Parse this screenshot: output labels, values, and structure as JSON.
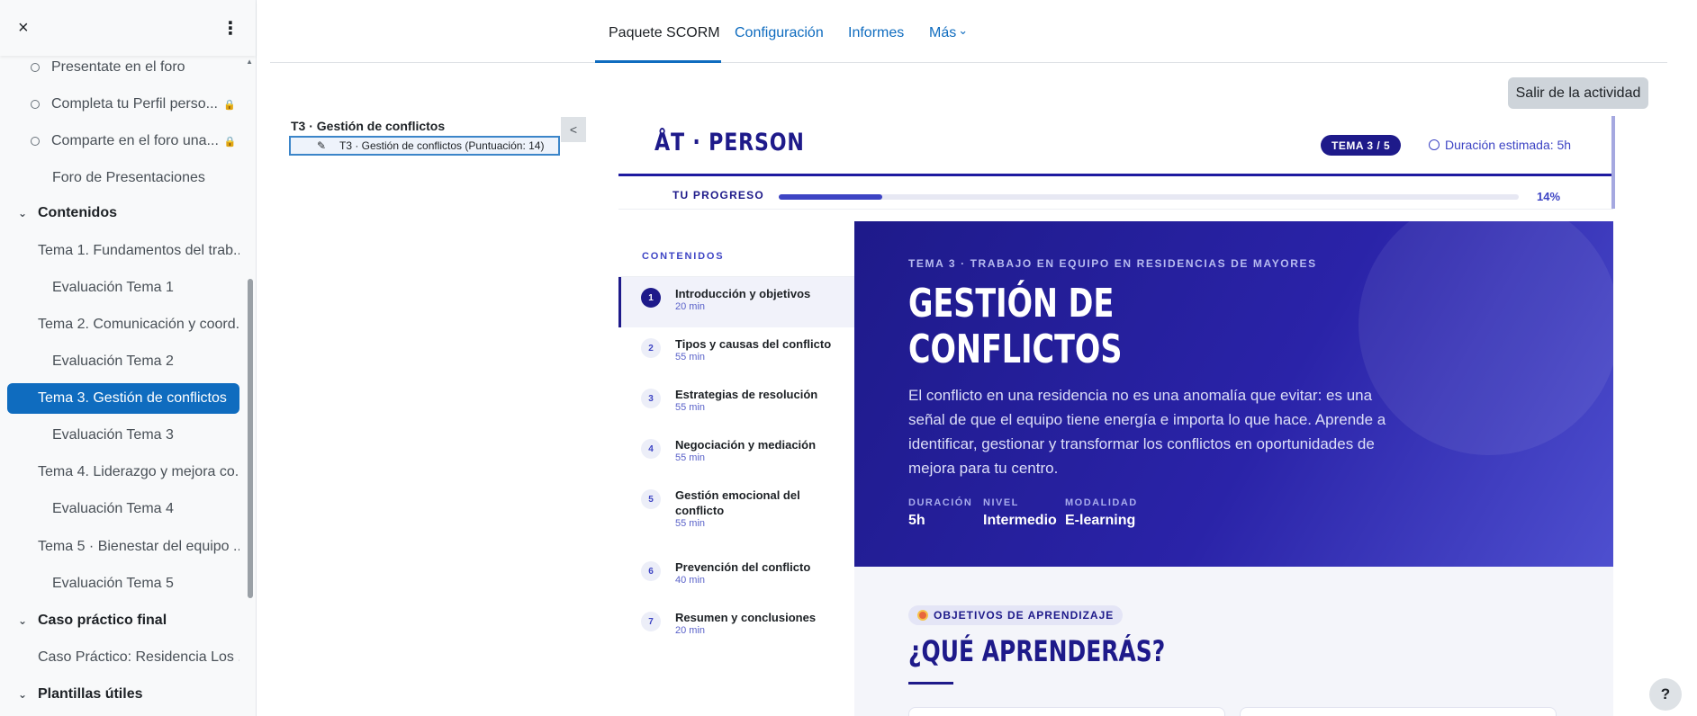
{
  "drawer": {
    "close_icon": "×",
    "menu_icon": "⋮",
    "items": [
      {
        "label": "Presentate en el foro",
        "kind": "activity",
        "circle": true,
        "lock": false,
        "active": false
      },
      {
        "label": "Completa tu Perfil perso...",
        "kind": "activity",
        "circle": true,
        "lock": true,
        "active": false
      },
      {
        "label": "Comparte en el foro una...",
        "kind": "activity",
        "circle": true,
        "lock": true,
        "active": false
      },
      {
        "label": "Foro de Presentaciones",
        "kind": "activity",
        "circle": false,
        "lock": false,
        "active": false
      },
      {
        "label": "Contenidos",
        "kind": "section"
      },
      {
        "label": "Tema 1. Fundamentos del trab...",
        "kind": "topic"
      },
      {
        "label": "Evaluación Tema 1",
        "kind": "activity",
        "circle": false
      },
      {
        "label": "Tema 2. Comunicación y coord...",
        "kind": "topic"
      },
      {
        "label": "Evaluación Tema 2",
        "kind": "activity",
        "circle": false
      },
      {
        "label": "Tema 3. Gestión de conflictos",
        "kind": "topic",
        "active": true
      },
      {
        "label": "Evaluación Tema 3",
        "kind": "activity",
        "circle": false
      },
      {
        "label": "Tema 4. Liderazgo y mejora co...",
        "kind": "topic"
      },
      {
        "label": "Evaluación Tema 4",
        "kind": "activity",
        "circle": false
      },
      {
        "label": "Tema 5 · Bienestar del equipo ...",
        "kind": "topic"
      },
      {
        "label": "Evaluación Tema 5",
        "kind": "activity",
        "circle": false
      },
      {
        "label": "Caso práctico final",
        "kind": "section"
      },
      {
        "label": "Caso Práctico: Residencia Los ...",
        "kind": "topic"
      },
      {
        "label": "Plantillas útiles",
        "kind": "section"
      }
    ]
  },
  "nav": {
    "tabs": [
      "Paquete SCORM",
      "Configuración",
      "Informes",
      "Más"
    ],
    "more_caret": "⌄",
    "selected": "Paquete SCORM"
  },
  "exit_button": "Salir de la actividad",
  "toc": {
    "title": "T3 · Gestión de conflictos",
    "item": "T3 · Gestión de conflictos (Puntuación: 14)",
    "edit_icon": "✎",
    "collapse": "<"
  },
  "scorm": {
    "brand": "ÅT · PERSON",
    "tema_badge": "TEMA 3 / 5",
    "duration_estimate": "Duración estimada: 5h",
    "progress_label": "TU PROGRESO",
    "progress_pct": "14%",
    "progress_value": 0.14,
    "contents_heading": "CONTENIDOS",
    "chapters": [
      {
        "n": "1",
        "title": "Introducción y objetivos",
        "min": "20 min"
      },
      {
        "n": "2",
        "title": "Tipos y causas del conflicto",
        "min": "55 min"
      },
      {
        "n": "3",
        "title": "Estrategias de resolución",
        "min": "55 min"
      },
      {
        "n": "4",
        "title": "Negociación y mediación",
        "min": "55 min"
      },
      {
        "n": "5",
        "title": "Gestión emocional del conflicto",
        "min": "55 min"
      },
      {
        "n": "6",
        "title": "Prevención del conflicto",
        "min": "40 min"
      },
      {
        "n": "7",
        "title": "Resumen y conclusiones",
        "min": "20 min"
      }
    ],
    "hero": {
      "kicker": "TEMA 3 · TRABAJO EN EQUIPO EN RESIDENCIAS DE MAYORES",
      "title_line1": "GESTIÓN DE",
      "title_line2": "CONFLICTOS",
      "description": "El conflicto en una residencia no es una anomalía que evitar: es una señal de que el equipo tiene energía e importa lo que hace. Aprende a identificar, gestionar y transformar los conflictos en oportunidades de mejora para tu centro.",
      "meta": [
        {
          "key": "DURACIÓN",
          "value": "5h"
        },
        {
          "key": "NIVEL",
          "value": "Intermedio"
        },
        {
          "key": "MODALIDAD",
          "value": "E-learning"
        }
      ]
    },
    "objectives": {
      "pill": "OBJETIVOS DE APRENDIZAJE",
      "title": "¿QUÉ APRENDERÁS?"
    }
  },
  "help": "?",
  "colors": {
    "accent": "#0f6cbf",
    "brand": "#1e1a8a",
    "brand_light": "#3d44c4"
  }
}
